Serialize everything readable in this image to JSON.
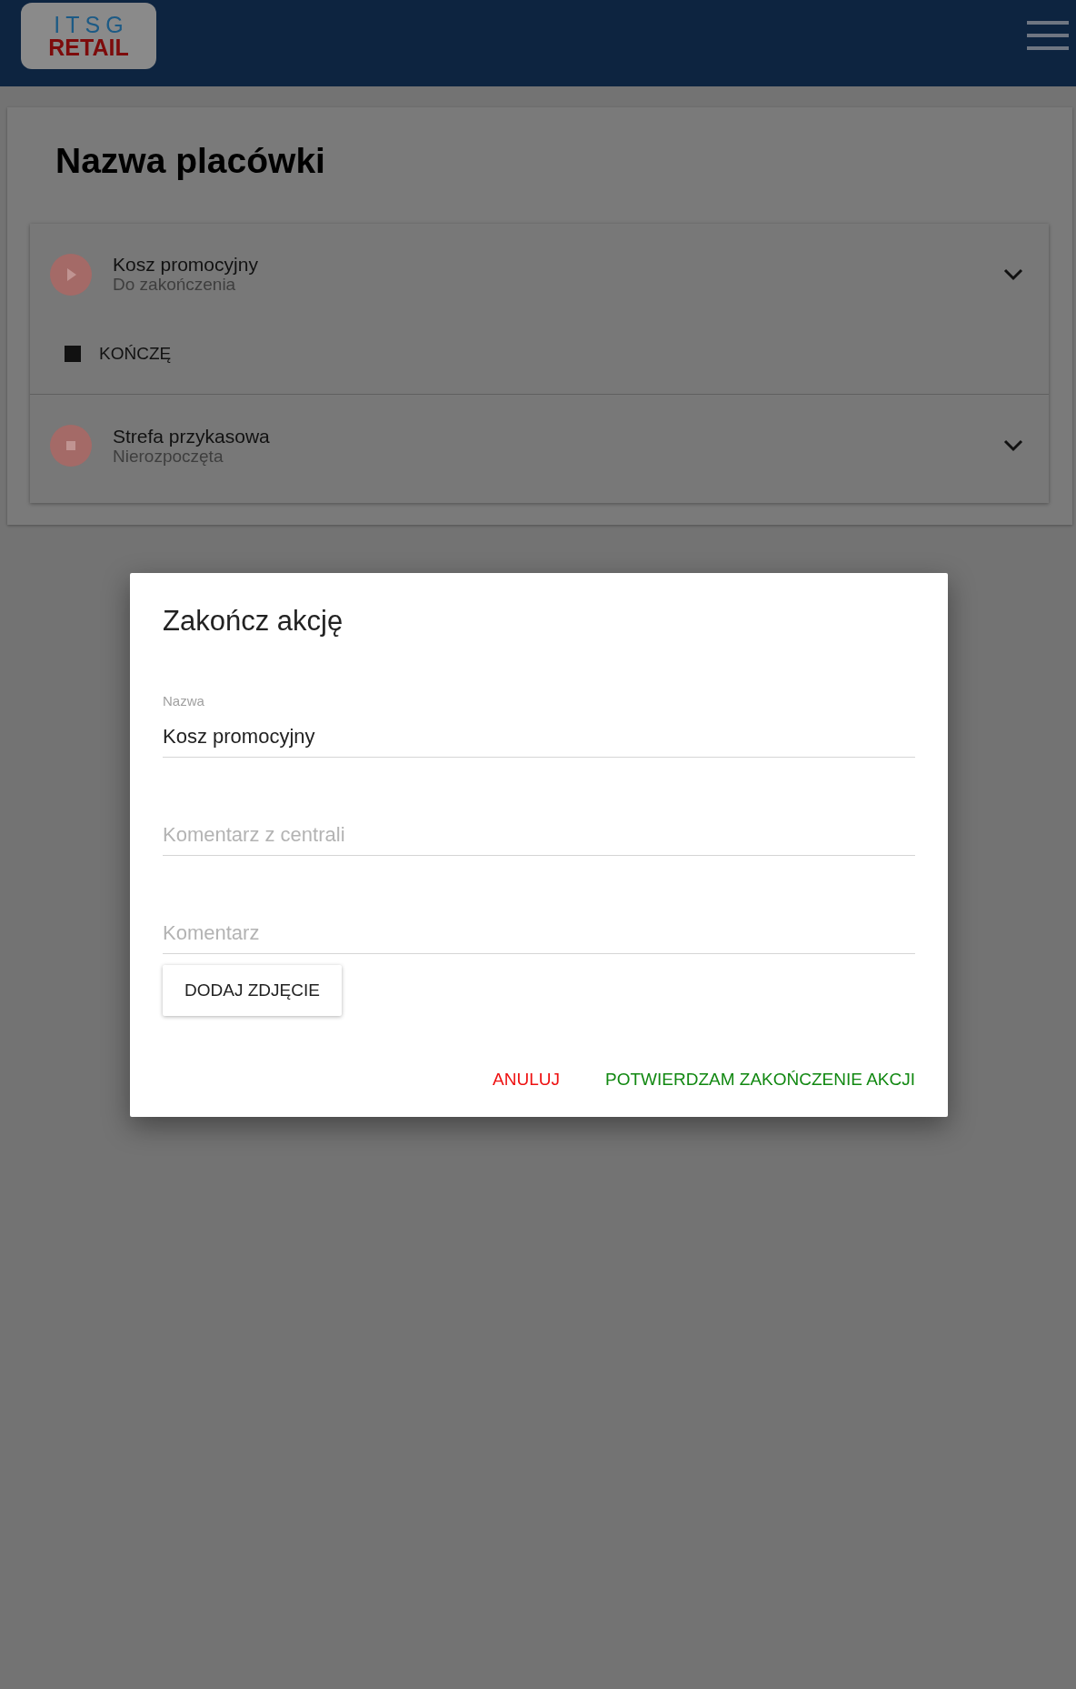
{
  "header": {
    "logo_top": "ITSG",
    "logo_bottom": "RETAIL"
  },
  "page": {
    "title": "Nazwa placówki"
  },
  "actions": [
    {
      "name": "Kosz promocyjny",
      "status": "Do zakończenia",
      "kind": "play",
      "expanded": true,
      "action_label": "KOŃCZĘ"
    },
    {
      "name": "Strefa przykasowa",
      "status": "Nierozpoczęta",
      "kind": "stop",
      "expanded": false
    }
  ],
  "dialog": {
    "title": "Zakończ akcję",
    "fields": [
      {
        "label": "Nazwa",
        "value": "Kosz promocyjny"
      },
      {
        "placeholder": "Komentarz z centrali"
      },
      {
        "placeholder": "Komentarz"
      }
    ],
    "photo_button": "DODAJ ZDJĘCIE",
    "cancel": "ANULUJ",
    "confirm": "POTWIERDZAM ZAKOŃCZENIE AKCJI"
  }
}
